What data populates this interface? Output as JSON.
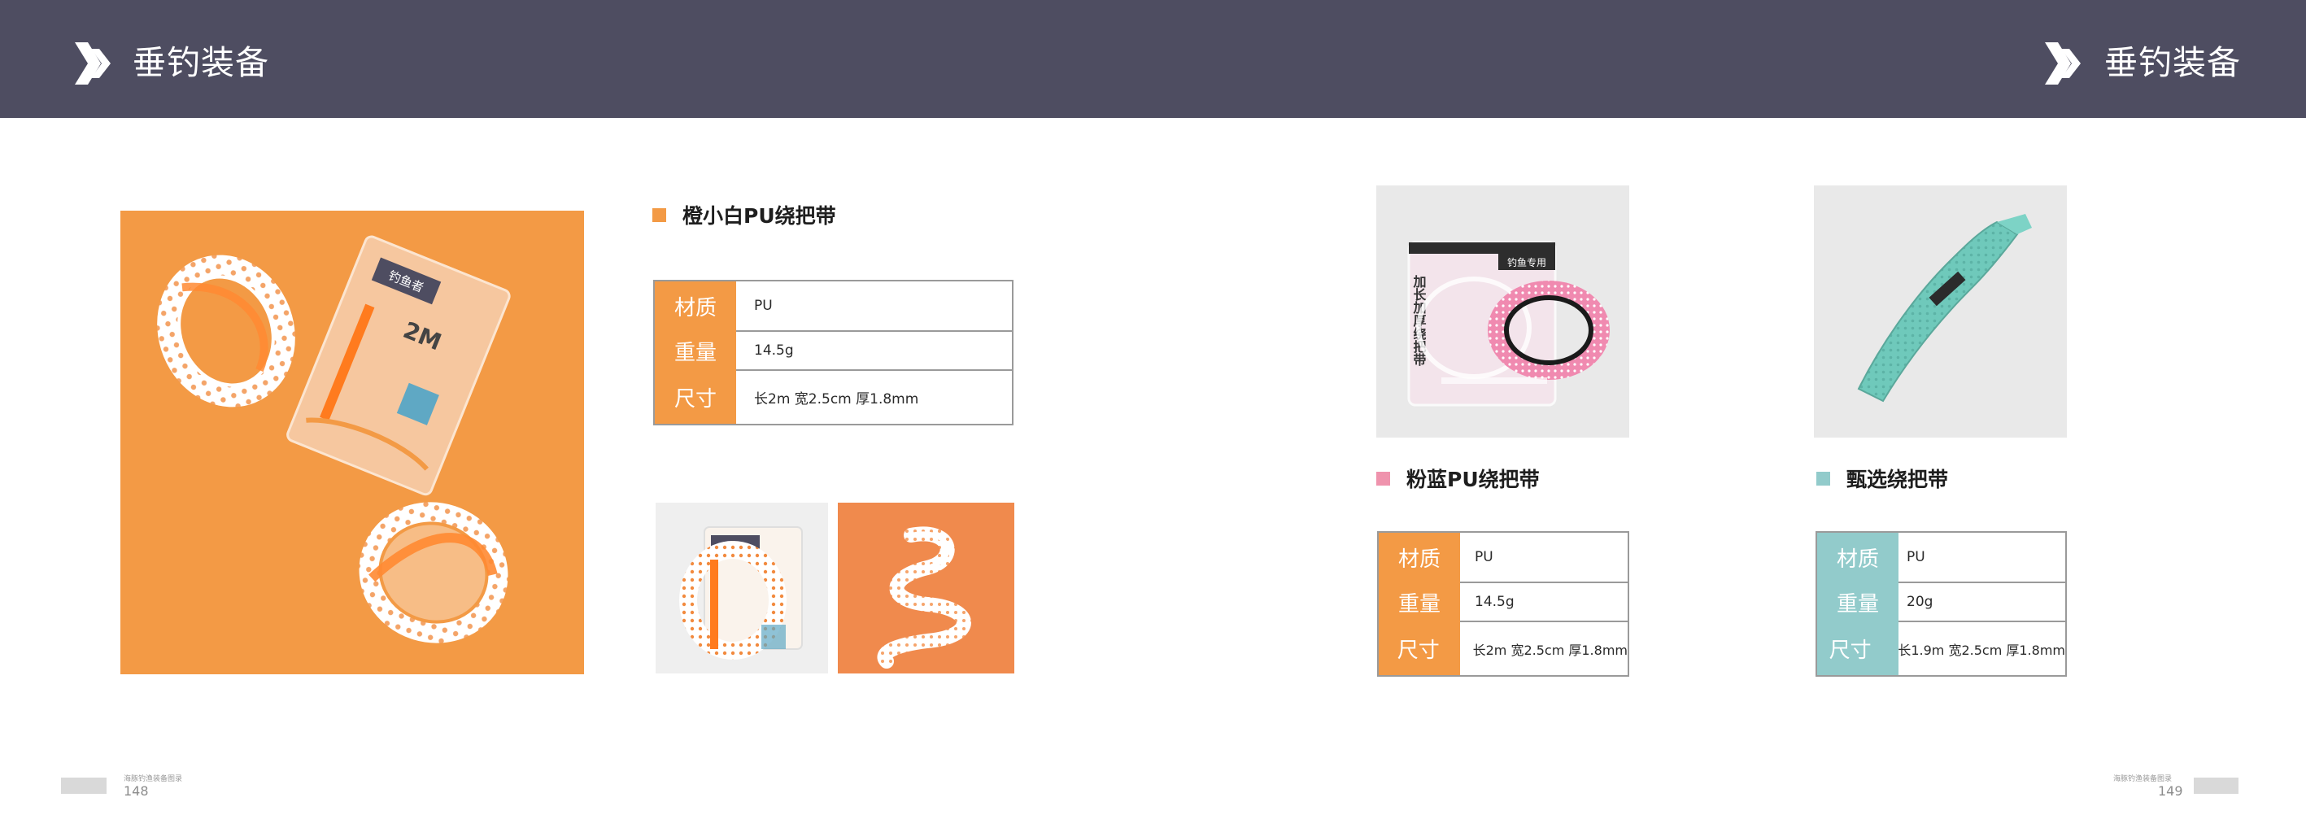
{
  "header": {
    "left_title": "垂钓装备",
    "right_title": "垂钓装备"
  },
  "colors": {
    "header_bg": "#4e4d61",
    "orange": "#f39a45",
    "pink": "#ef93ad",
    "teal": "#92cbcb"
  },
  "icons": {
    "header": "double-chevron-right-icon"
  },
  "products": [
    {
      "name": "橙小白PU绕把带",
      "color": "#f39a45",
      "specs": [
        {
          "label": "材质",
          "value": "PU"
        },
        {
          "label": "重量",
          "value": "14.5g"
        },
        {
          "label": "尺寸",
          "value": "长2m  宽2.5cm    厚1.8mm"
        }
      ]
    },
    {
      "name": "粉蓝PU绕把带",
      "color": "#ef93ad",
      "specs": [
        {
          "label": "材质",
          "value": "PU"
        },
        {
          "label": "重量",
          "value": "14.5g"
        },
        {
          "label": "尺寸",
          "value": "长2m  宽2.5cm  厚1.8mm"
        }
      ]
    },
    {
      "name": "甄选绕把带",
      "color": "#92cbcb",
      "specs": [
        {
          "label": "材质",
          "value": "PU"
        },
        {
          "label": "重量",
          "value": "20g"
        },
        {
          "label": "尺寸",
          "value": "长1.9m  宽2.5cm  厚1.8mm"
        }
      ]
    }
  ],
  "package_text": {
    "brand": "钓鱼者",
    "length": "2M",
    "pink_vertical": "加长加厚绕把带",
    "pink_label": "钓鱼专用"
  },
  "footer": {
    "left_caption": "海豚钓渔装备图录",
    "left_page": "148",
    "right_caption": "海豚钓渔装备图录",
    "right_page": "149"
  }
}
